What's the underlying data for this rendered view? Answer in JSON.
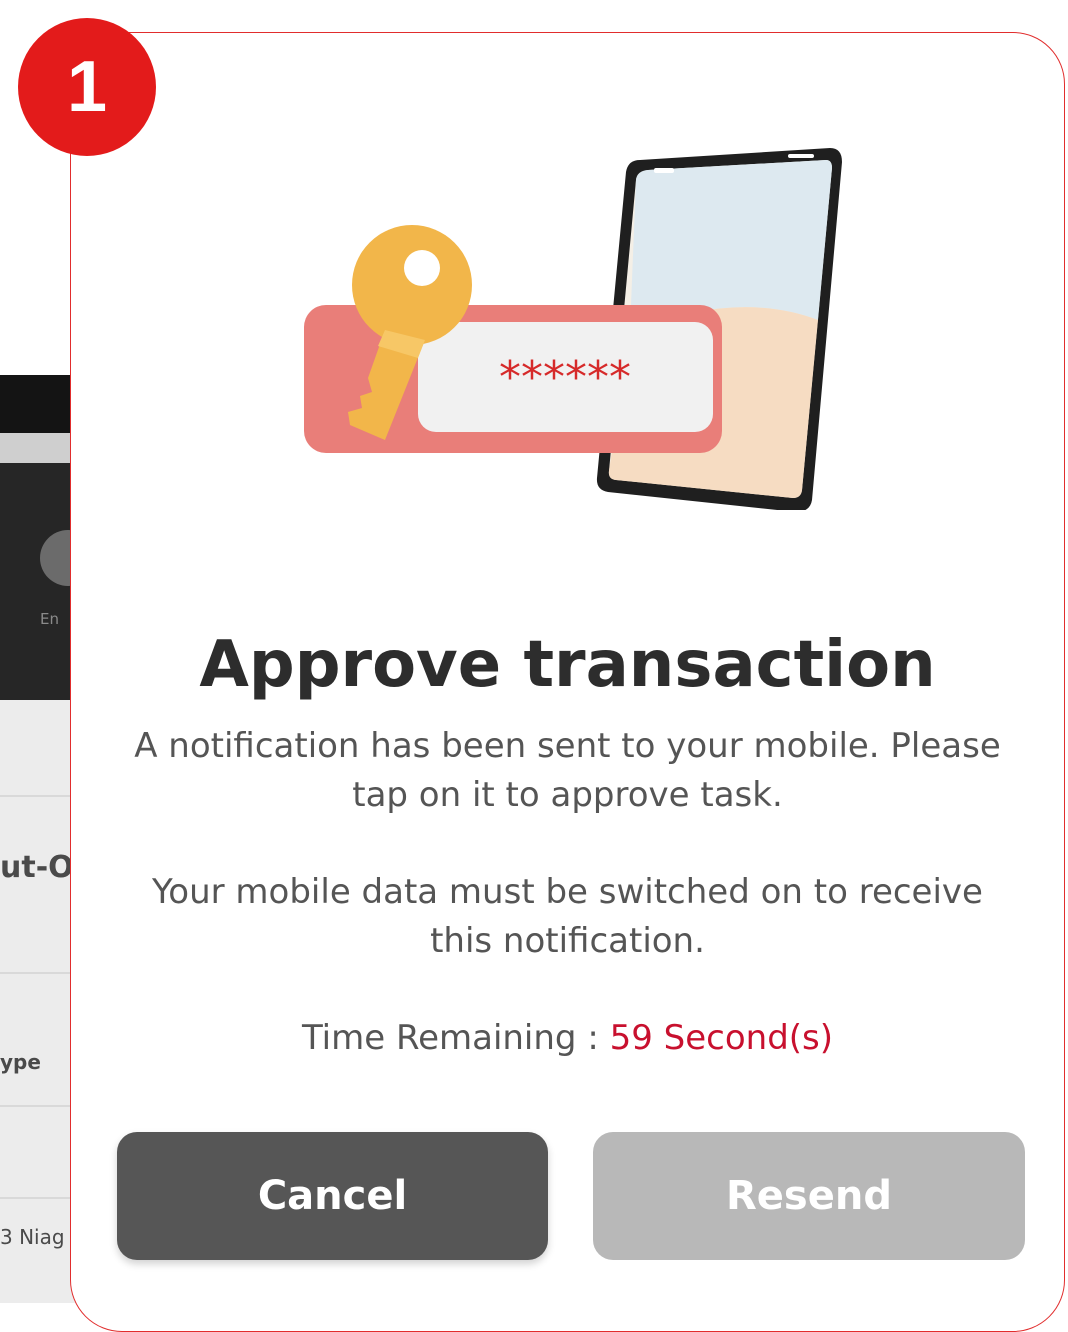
{
  "step": {
    "number": "1"
  },
  "background_app": {
    "icon_label": "En",
    "row_1": "ut-Of",
    "row_2": "ype",
    "row_3": "3 Niag"
  },
  "modal": {
    "title": "Approve transaction",
    "description_line_1": "A notification has been sent to your mobile. Please",
    "description_line_2": "tap on it to approve task.",
    "note_line_1": "Your mobile data must be switched on to receive",
    "note_line_2": "this notification.",
    "time_label": "Time Remaining : ",
    "time_value": "59 Second(s)",
    "masked_pin": "******"
  },
  "buttons": {
    "cancel": "Cancel",
    "resend": "Resend"
  },
  "colors": {
    "accent_red": "#e31b1b",
    "time_red": "#c8102e",
    "cancel_bg": "#565656",
    "resend_bg": "#b8b8b8"
  }
}
